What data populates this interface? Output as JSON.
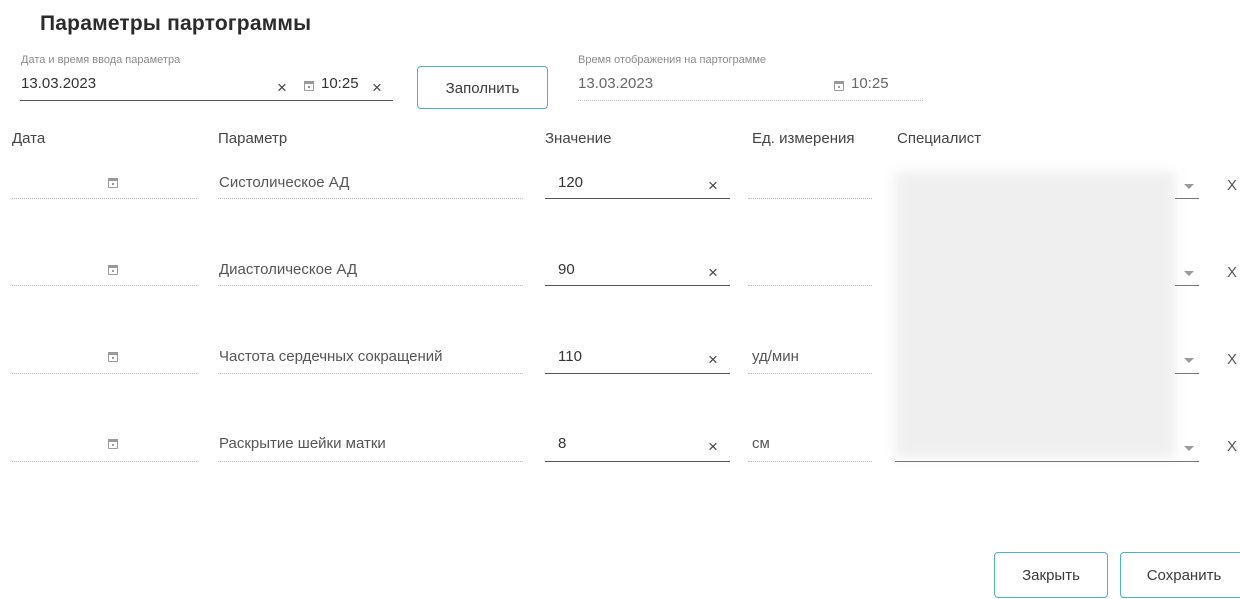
{
  "header": {
    "title": "Параметры партограммы",
    "input_datetime_label": "Дата и время ввода параметра",
    "input_date": "13.03.2023",
    "input_time": "10:25",
    "fill_button": "Заполнить",
    "display_time_label": "Время отображения на партограмме",
    "display_date": "13.03.2023",
    "display_time": "10:25"
  },
  "table": {
    "columns": [
      "Дата",
      "Параметр",
      "Значение",
      "Ед. измерения",
      "Специалист"
    ],
    "rows": [
      {
        "parameter": "Систолическое АД",
        "value": "120",
        "unit": ""
      },
      {
        "parameter": "Диастолическое АД",
        "value": "90",
        "unit": ""
      },
      {
        "parameter": "Частота сердечных сокращений",
        "value": "110",
        "unit": "уд/мин"
      },
      {
        "parameter": "Раскрытие шейки матки",
        "value": "8",
        "unit": "см"
      }
    ],
    "clear_glyph": "×",
    "remove_glyph": "X"
  },
  "footer": {
    "close_button": "Закрыть",
    "save_button": "Сохранить"
  }
}
